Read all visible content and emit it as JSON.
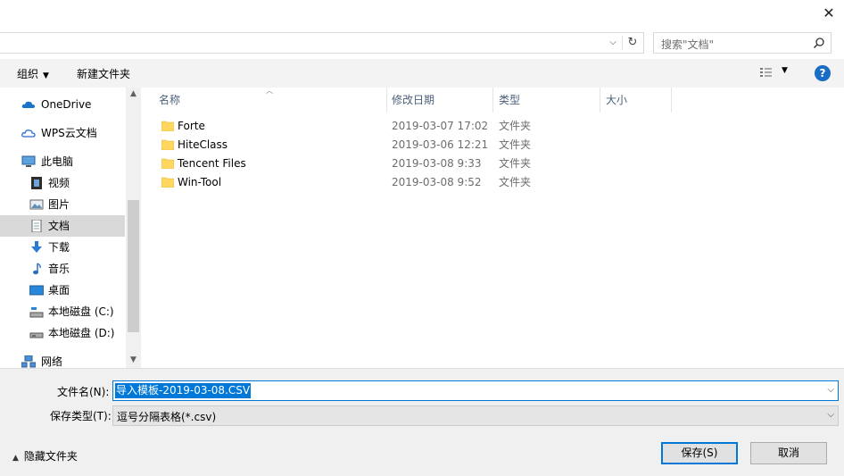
{
  "window": {
    "close_icon": "close-icon"
  },
  "address": {
    "path": "",
    "chevron_icon": "chevron-down-icon",
    "refresh_icon": "refresh-icon"
  },
  "search": {
    "placeholder": "搜索\"文档\""
  },
  "toolbar": {
    "organize_label": "组织",
    "new_folder_label": "新建文件夹",
    "help_label": "?"
  },
  "nav": {
    "items": [
      {
        "label": "OneDrive",
        "icon": "cloud-icon",
        "selected": false
      },
      {
        "label": "WPS云文档",
        "icon": "cloud-outline-icon",
        "selected": false
      },
      {
        "label": "此电脑",
        "icon": "computer-icon",
        "selected": false
      },
      {
        "label": "视频",
        "icon": "video-icon",
        "selected": false
      },
      {
        "label": "图片",
        "icon": "picture-icon",
        "selected": false
      },
      {
        "label": "文档",
        "icon": "document-icon",
        "selected": true
      },
      {
        "label": "下载",
        "icon": "download-icon",
        "selected": false
      },
      {
        "label": "音乐",
        "icon": "music-icon",
        "selected": false
      },
      {
        "label": "桌面",
        "icon": "desktop-icon",
        "selected": false
      },
      {
        "label": "本地磁盘 (C:)",
        "icon": "drive-c-icon",
        "selected": false
      },
      {
        "label": "本地磁盘 (D:)",
        "icon": "drive-icon",
        "selected": false
      },
      {
        "label": "网络",
        "icon": "network-icon",
        "selected": false
      }
    ]
  },
  "files": {
    "columns": [
      "名称",
      "修改日期",
      "类型",
      "大小"
    ],
    "rows": [
      {
        "name": "Forte",
        "date": "2019-03-07 17:02",
        "type": "文件夹"
      },
      {
        "name": "HiteClass",
        "date": "2019-03-06 12:21",
        "type": "文件夹"
      },
      {
        "name": "Tencent Files",
        "date": "2019-03-08 9:33",
        "type": "文件夹"
      },
      {
        "name": "Win-Tool",
        "date": "2019-03-08 9:52",
        "type": "文件夹"
      }
    ]
  },
  "form": {
    "filename_label": "文件名(N):",
    "filename_value": "导入模板-2019-03-08.CSV",
    "type_label": "保存类型(T):",
    "type_value": "逗号分隔表格(*.csv)"
  },
  "footer": {
    "hide_folders_label": "隐藏文件夹",
    "save_label": "保存(S)",
    "cancel_label": "取消"
  },
  "colors": {
    "accent": "#0078d7",
    "selection": "#d9d9d9",
    "folder": "#ffd75e",
    "help": "#1a6dc4"
  }
}
